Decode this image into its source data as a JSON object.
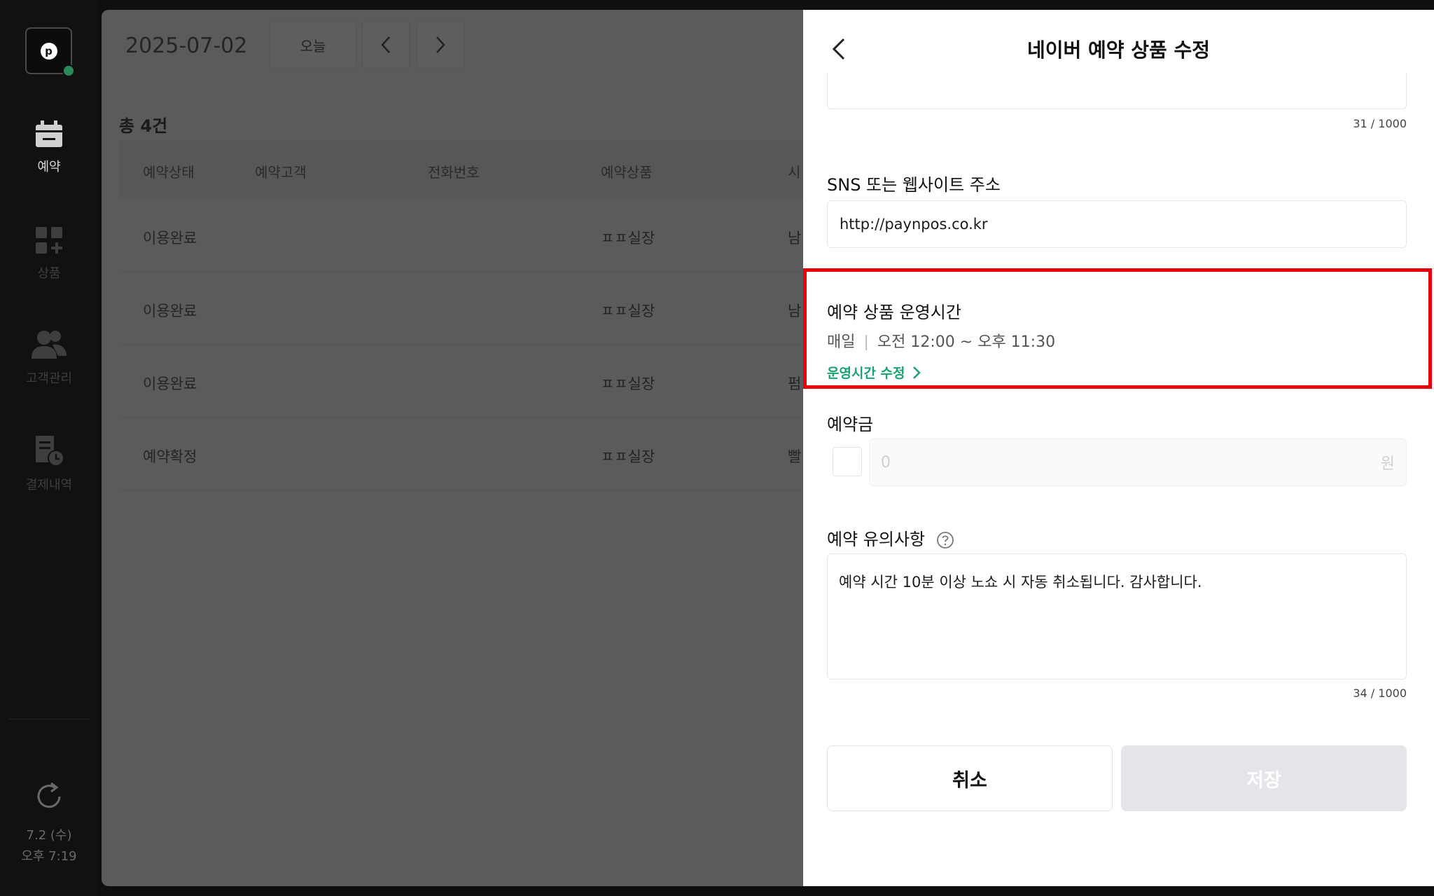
{
  "rail": {
    "items": [
      {
        "label": "예약",
        "icon": "calendar-icon"
      },
      {
        "label": "상품",
        "icon": "grid-plus-icon"
      },
      {
        "label": "고객관리",
        "icon": "users-icon"
      },
      {
        "label": "결제내역",
        "icon": "receipt-clock-icon"
      }
    ],
    "date": "7.2 (수)",
    "time": "오후 7:19"
  },
  "main": {
    "date": "2025-07-02",
    "today_label": "오늘",
    "total": "총 4건",
    "columns": [
      "예약상태",
      "예약고객",
      "전화번호",
      "예약상품",
      "시"
    ],
    "rows": [
      {
        "status": "이용완료",
        "product": "ㅍㅍ실장",
        "clip": "남"
      },
      {
        "status": "이용완료",
        "product": "ㅍㅍ실장",
        "clip": "남"
      },
      {
        "status": "이용완료",
        "product": "ㅍㅍ실장",
        "clip": "펌"
      },
      {
        "status": "예약확정",
        "product": "ㅍㅍ실장",
        "clip": "빨"
      }
    ]
  },
  "panel": {
    "title": "네이버 예약 상품 수정",
    "top_counter": "31 / 1000",
    "sns_label": "SNS 또는 웹사이트 주소",
    "sns_value": "http://paynpos.co.kr",
    "hours_title": "예약 상품 운영시간",
    "hours_day": "매일",
    "hours_range": "오전 12:00 ~ 오후 11:30",
    "hours_link": "운영시간 수정",
    "deposit_label": "예약금",
    "deposit_value": "0",
    "deposit_unit": "원",
    "notice_label": "예약 유의사항",
    "notice_value": "예약 시간 10분 이상 노쇼 시 자동 취소됩니다. 감사합니다.",
    "notice_counter": "34 / 1000",
    "cancel_label": "취소",
    "save_label": "저장"
  },
  "colors": {
    "highlight": "#e8000b",
    "link": "#19a36f",
    "save_disabled": "#e3e5e8"
  }
}
